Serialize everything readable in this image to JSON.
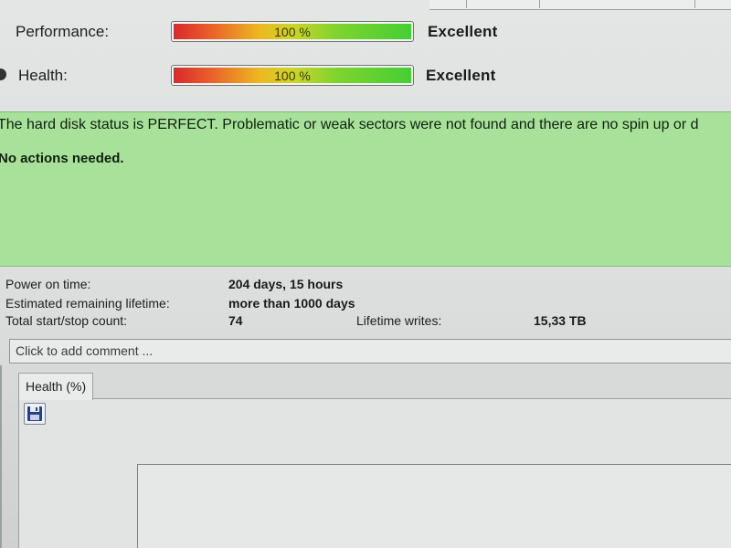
{
  "window": {
    "tab_strip": [
      "",
      "",
      ""
    ]
  },
  "gauges": {
    "performance": {
      "label": "Performance:",
      "value": 100,
      "value_text": "100 %",
      "rating": "Excellent"
    },
    "health": {
      "label": "Health:",
      "value": 100,
      "value_text": "100 %",
      "rating": "Excellent"
    }
  },
  "status": {
    "message": "The hard disk status is PERFECT. Problematic or weak sectors were not found and there are no spin up or d",
    "action": "No actions needed.",
    "background_color": "#a8e29a"
  },
  "stats": {
    "power_on_time": {
      "label": "Power on time:",
      "value": "204 days, 15 hours"
    },
    "remaining_lifetime": {
      "label": "Estimated remaining lifetime:",
      "value": "more than 1000 days"
    },
    "start_stop_count": {
      "label": "Total start/stop count:",
      "value": "74"
    },
    "lifetime_writes": {
      "label": "Lifetime writes:",
      "value": "15,33 TB"
    }
  },
  "comment": {
    "placeholder": "Click to add comment ..."
  },
  "tabs": [
    {
      "label": "Health (%)",
      "active": true
    }
  ],
  "toolbar": {
    "save_icon": "floppy-disk-icon"
  }
}
